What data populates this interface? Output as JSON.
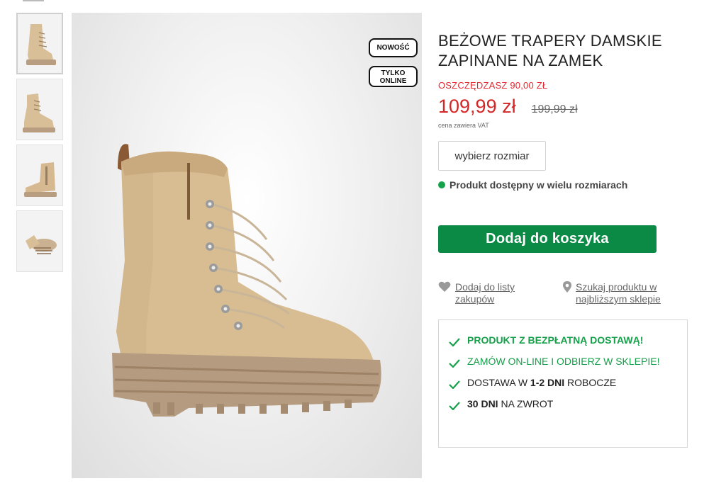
{
  "badges": {
    "new": "NOWOŚĆ",
    "online_line1": "TYLKO",
    "online_line2": "ONLINE"
  },
  "product": {
    "title": "BEŻOWE TRAPERY DAMSKIE ZAPINANE NA ZAMEK",
    "savings": "OSZCZĘDZASZ 90,00 ZŁ",
    "price_now": "109,99 zł",
    "price_old": "199,99 zł",
    "vat_note": "cena zawiera VAT",
    "size_button": "wybierz rozmiar",
    "availability": "Produkt dostępny w wielu rozmiarach",
    "cart_button": "Dodaj do koszyka"
  },
  "links": {
    "favorites": "Dodaj do listy zakupów",
    "store": "Szukaj produktu w najbliższym sklepie"
  },
  "benefits": {
    "b1": "PRODUKT Z BEZPŁATNĄ DOSTAWĄ!",
    "b2": "ZAMÓW ON-LINE I ODBIERZ W SKLEPIE!",
    "b3_pre": "DOSTAWA W ",
    "b3_bold": "1-2 DNI",
    "b3_post": " ROBOCZE",
    "b4_bold": "30 DNI",
    "b4_post": " NA ZWROT"
  },
  "colors": {
    "accent_green": "#0a8a45",
    "price_red": "#d42626",
    "available_dot": "#14a34a"
  },
  "icons": [
    "heart-icon",
    "location-pin-icon",
    "check-icon"
  ]
}
